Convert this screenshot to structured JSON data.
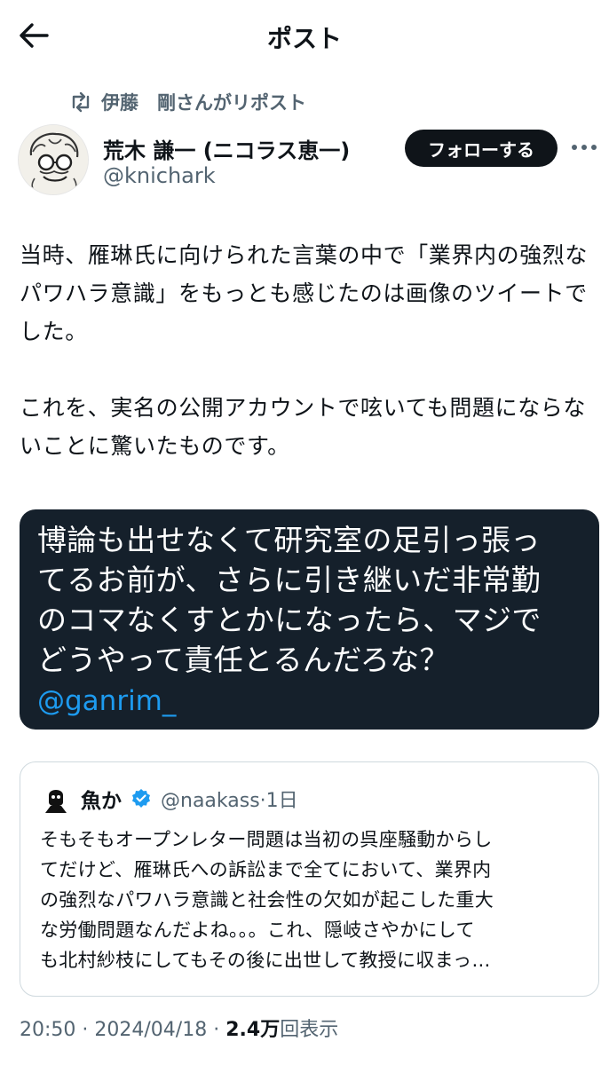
{
  "header": {
    "title": "ポスト",
    "back_icon": "arrow-left-icon"
  },
  "repost": {
    "icon": "retweet-icon",
    "text": "伊藤　剛さんがリポスト"
  },
  "author": {
    "name": "荒木 謙一 (ニコラス恵一)",
    "handle": "@knichark",
    "follow_label": "フォローする",
    "more_icon": "more-icon"
  },
  "post": {
    "paragraphs": [
      "当時、雁琳氏に向けられた言葉の中で「業界内の強烈なパワハラ意識」をもっとも感じたのは画像のツイートでした。",
      "これを、実名の公開アカウントで呟いても問題にならないことに驚いたものです。"
    ]
  },
  "media": {
    "lines": [
      "博論も出せなくて研究室の足引っ張っ",
      "てるお前が、さらに引き継いだ非常勤",
      "のコマなくすとかになったら、マジで",
      "どうやって責任とるんだろな？"
    ],
    "mention": "@ganrim_",
    "background": "#15202b",
    "mention_color": "#1d9bf0"
  },
  "quote": {
    "name": "魚か",
    "verified_icon": "verified-badge-icon",
    "handle": "@naakass",
    "sep": "·",
    "time": "1日",
    "lines": [
      "そもそもオープンレター問題は当初の呉座騒動からし",
      "てだけど、雁琳氏への訴訟まで全てにおいて、業界内",
      "の強烈なパワハラ意識と社会性の欠如が起こした重大",
      "な労働問題なんだよね。。。これ、隠岐さやかにして",
      "も北村紗枝にしてもその後に出世して教授に収まっ…"
    ]
  },
  "meta": {
    "time": "20:50",
    "sep1": "·",
    "date": "2024/04/18",
    "sep2": "·",
    "views": "2.4万",
    "views_label": "回表示"
  }
}
